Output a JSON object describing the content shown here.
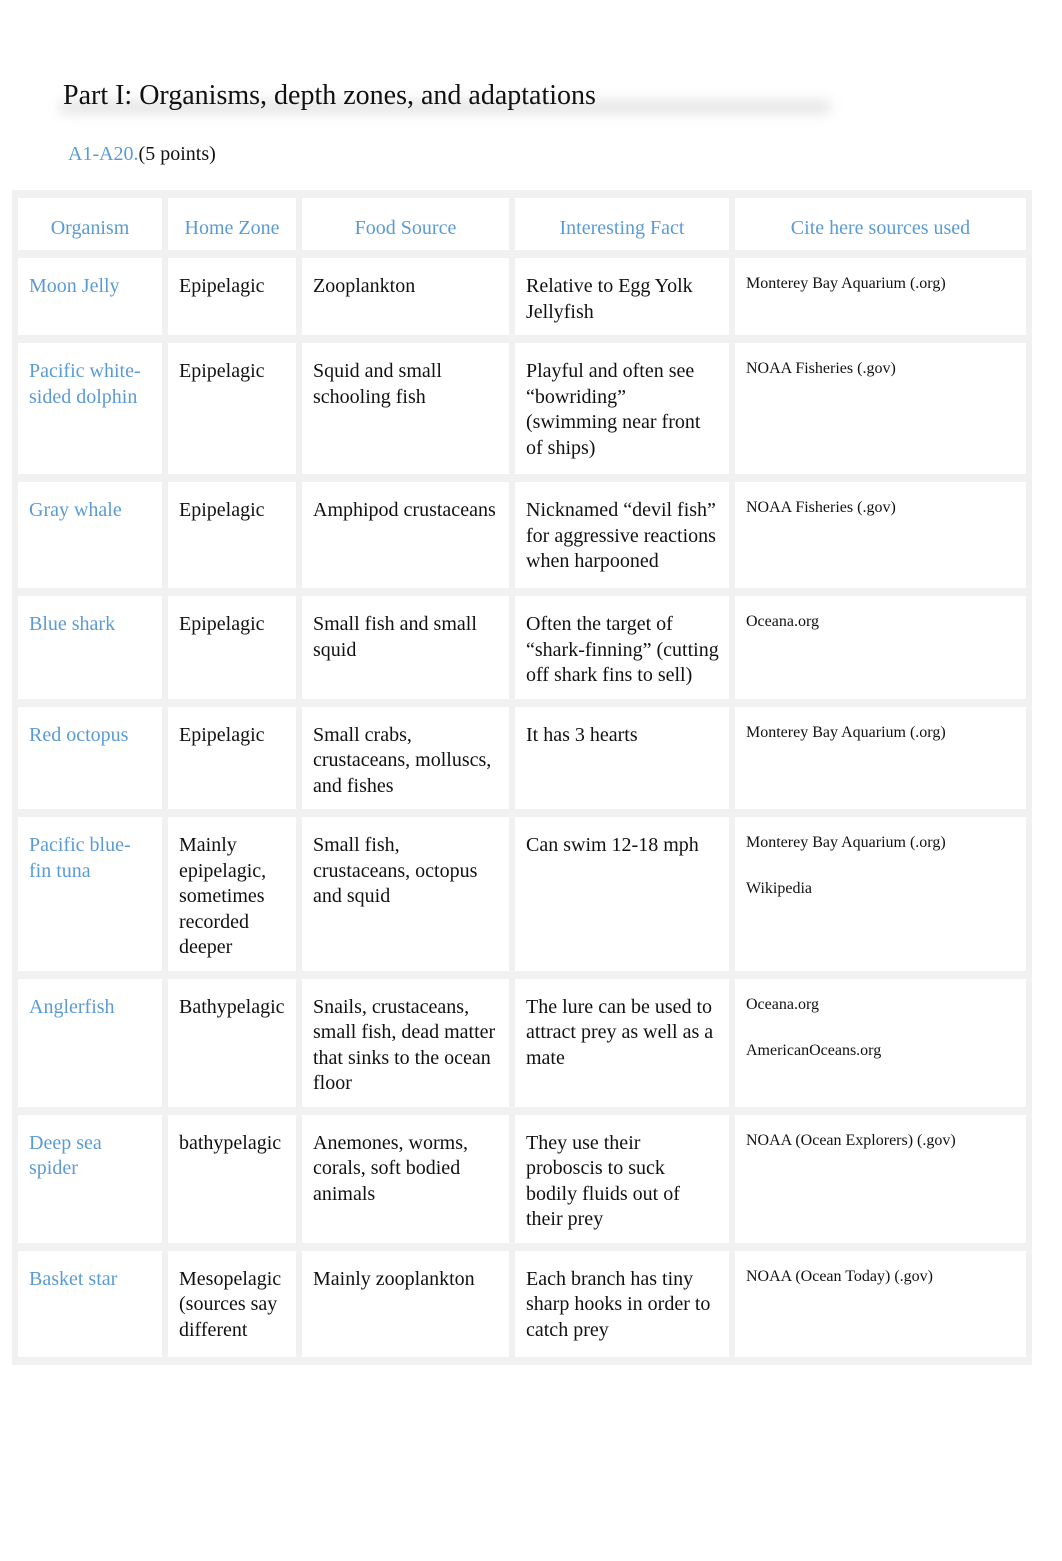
{
  "heading": "Part I: Organisms, depth zones, and adaptations",
  "subheading": {
    "label": "A1-A20.",
    "points": "(5 points)"
  },
  "colors": {
    "accent": "#5b9bd5"
  },
  "table": {
    "headers": [
      "Organism",
      "Home Zone",
      "Food Source",
      "Interesting Fact",
      "Cite here sources used"
    ],
    "rows": [
      {
        "organism": "Moon Jelly",
        "zone": "Epipelagic",
        "food": "Zooplankton",
        "fact": "Relative to Egg Yolk Jellyfish",
        "sources": [
          "Monterey Bay Aquarium (.org)"
        ]
      },
      {
        "organism": "Pacific white-sided dolphin",
        "zone": "Epipelagic",
        "food": "Squid and small schooling fish",
        "fact": "Playful and often see “bowriding” (swimming near front of ships)",
        "sources": [
          "NOAA Fisheries (.gov)"
        ]
      },
      {
        "organism": "Gray whale",
        "zone": "Epipelagic",
        "food": "Amphipod crustaceans",
        "fact": "Nicknamed “devil fish” for aggressive reactions when harpooned",
        "sources": [
          "NOAA Fisheries (.gov)"
        ]
      },
      {
        "organism": "Blue shark",
        "zone": "Epipelagic",
        "food": "Small fish and small squid",
        "fact": "Often the target of “shark-finning” (cutting off shark fins to sell)",
        "sources": [
          "Oceana.org"
        ]
      },
      {
        "organism": "Red octopus",
        "zone": "Epipelagic",
        "food": "Small crabs, crustaceans, molluscs, and fishes",
        "fact": "It has 3 hearts",
        "sources": [
          "Monterey Bay Aquarium (.org)"
        ]
      },
      {
        "organism": "Pacific blue-fin tuna",
        "zone": "Mainly epipelagic, sometimes recorded deeper",
        "food": "Small fish, crustaceans, octopus and squid",
        "fact": "Can swim 12-18 mph",
        "sources": [
          "Monterey Bay Aquarium (.org)",
          "Wikipedia"
        ]
      },
      {
        "organism": "Anglerfish",
        "zone": "Bathypelagic",
        "food": "Snails, crustaceans, small fish, dead matter that sinks to the ocean floor",
        "fact": "The lure can be used to attract prey as well as a mate",
        "sources": [
          "Oceana.org",
          "AmericanOceans.org"
        ]
      },
      {
        "organism": "Deep sea spider",
        "zone": "bathypelagic",
        "food": "Anemones, worms, corals, soft bodied animals",
        "fact": "They use their proboscis to suck bodily fluids out of their prey",
        "sources": [
          "NOAA (Ocean Explorers) (.gov)"
        ]
      },
      {
        "organism": "Basket star",
        "zone": "Mesopelagic (sources say different",
        "food": "Mainly zooplankton",
        "fact": "Each branch has tiny sharp hooks in order to catch prey",
        "sources": [
          "NOAA (Ocean Today) (.gov)"
        ]
      }
    ]
  }
}
